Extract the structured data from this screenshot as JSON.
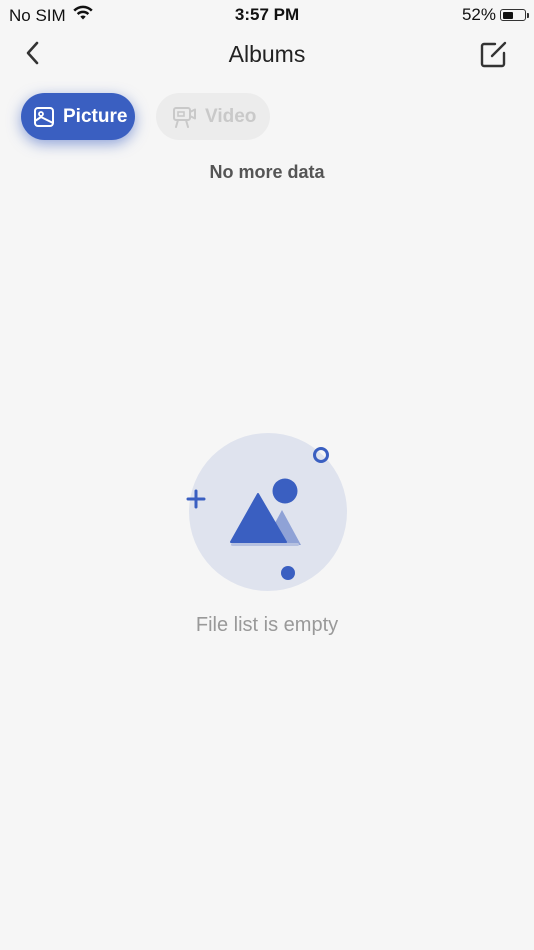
{
  "status_bar": {
    "carrier": "No SIM",
    "time": "3:57 PM",
    "battery_percent": "52%",
    "battery_level": 0.52,
    "wifi_icon": "wifi-icon",
    "battery_icon": "battery-icon"
  },
  "nav": {
    "title": "Albums",
    "back_icon": "chevron-left-icon",
    "edit_icon": "edit-icon"
  },
  "tabs": [
    {
      "label": "Picture",
      "icon": "picture-icon",
      "active": true
    },
    {
      "label": "Video",
      "icon": "video-icon",
      "active": false
    }
  ],
  "list": {
    "no_more_text": "No more data"
  },
  "empty_state": {
    "message": "File list is empty",
    "illustration_icon": "empty-image-illustration"
  },
  "colors": {
    "accent": "#3a5fc1",
    "background": "#f6f6f6",
    "illustration_bg": "#dfe3ee"
  }
}
